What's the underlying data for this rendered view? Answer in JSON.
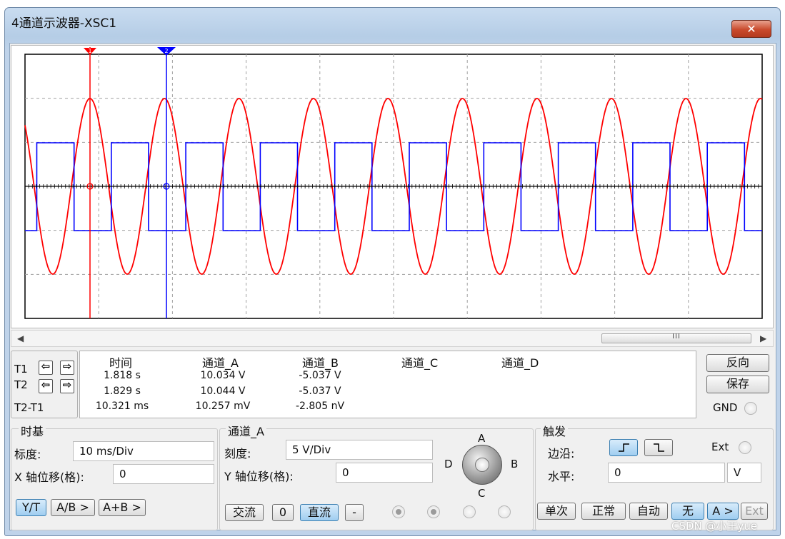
{
  "window": {
    "title": "4通道示波器-XSC1",
    "close_label": "✕"
  },
  "colors": {
    "channel_a": "#ff0000",
    "channel_b": "#0000ff",
    "grid": "#a0a0a0"
  },
  "cursors": {
    "t1_marker": "1",
    "t2_marker": "2"
  },
  "readout": {
    "row_labels": {
      "t1": "T1",
      "t2": "T2",
      "t2_t1": "T2-T1"
    },
    "headers": {
      "time": "时间",
      "channel_a": "通道_A",
      "channel_b": "通道_B",
      "channel_c": "通道_C",
      "channel_d": "通道_D"
    },
    "rows": [
      {
        "time": "1.818 s",
        "channel_a": "10.034 V",
        "channel_b": "-5.037 V"
      },
      {
        "time": "1.829 s",
        "channel_a": "10.044 V",
        "channel_b": "-5.037 V"
      },
      {
        "time": "10.321 ms",
        "channel_a": "10.257 mV",
        "channel_b": "-2.805 nV"
      }
    ]
  },
  "side_buttons": {
    "reverse": "反向",
    "save": "保存",
    "gnd": "GND"
  },
  "timebase": {
    "group_label": "时基",
    "scale_label": "标度:",
    "scale_value": "10 ms/Div",
    "xpos_label": "X 轴位移(格):",
    "xpos_value": "0",
    "modes": [
      "Y/T",
      "A/B >",
      "A+B >"
    ],
    "active_mode": "Y/T"
  },
  "channel": {
    "group_label": "通道_A",
    "scale_label": "刻度:",
    "scale_value": "5  V/Div",
    "ypos_label": "Y 轴位移(格):",
    "ypos_value": "0",
    "coupling": [
      "交流",
      "0",
      "直流",
      "-"
    ],
    "active_coupling": "直流",
    "knob_labels": {
      "a": "A",
      "b": "B",
      "c": "C",
      "d": "D"
    }
  },
  "trigger": {
    "group_label": "触发",
    "edge_label": "边沿:",
    "ext_label": "Ext",
    "level_label": "水平:",
    "level_value": "0",
    "level_unit": "V",
    "modes": [
      "单次",
      "正常",
      "自动",
      "无",
      "A >",
      "Ext"
    ],
    "active_mode": "无"
  },
  "scrollbar": {
    "grip": "III"
  },
  "watermark": "CSDN @小王yue"
}
